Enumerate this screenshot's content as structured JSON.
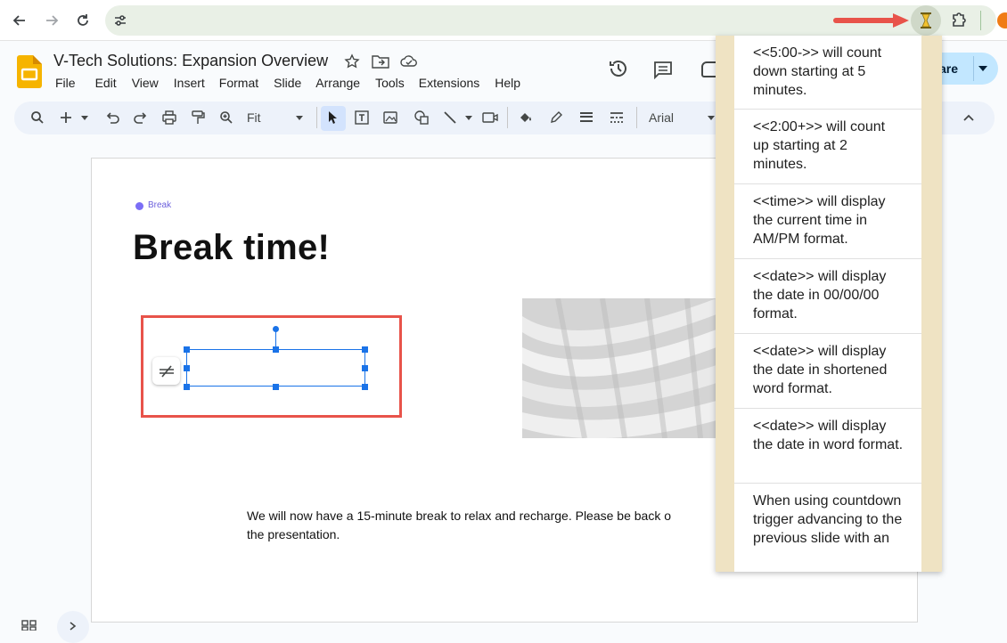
{
  "browser": {
    "extension_icons": [
      "hourglass-extension-icon",
      "puzzle-extensions-icon"
    ]
  },
  "doc": {
    "title": "V-Tech Solutions: Expansion Overview",
    "menu": [
      "File",
      "Edit",
      "View",
      "Insert",
      "Format",
      "Slide",
      "Arrange",
      "Tools",
      "Extensions",
      "Help"
    ],
    "share_label": "are"
  },
  "toolbar": {
    "zoom": "Fit",
    "font": "Arial"
  },
  "slide": {
    "tag": "Break",
    "heading": "Break time!",
    "body": "We will now have a 15-minute break to relax and recharge. Please be back o",
    "body_line2": "the presentation."
  },
  "popup": {
    "items": [
      "<<5:00->> will count down starting at 5 minutes.",
      "<<2:00+>> will count up starting at 2 minutes.",
      "<<time>> will display the current time in AM/PM format.",
      "<<date>> will display the date in 00/00/00 format.",
      "<<date>> will display the date in shortened word format.",
      "<<date>> will display the date in word format.",
      "When using countdown trigger advancing to the previous slide with an"
    ]
  },
  "colors": {
    "accent": "#1a73e8",
    "highlight_box": "#e8534a",
    "popup_side": "#efe3c3",
    "tag_dot": "#7b6ef6"
  }
}
